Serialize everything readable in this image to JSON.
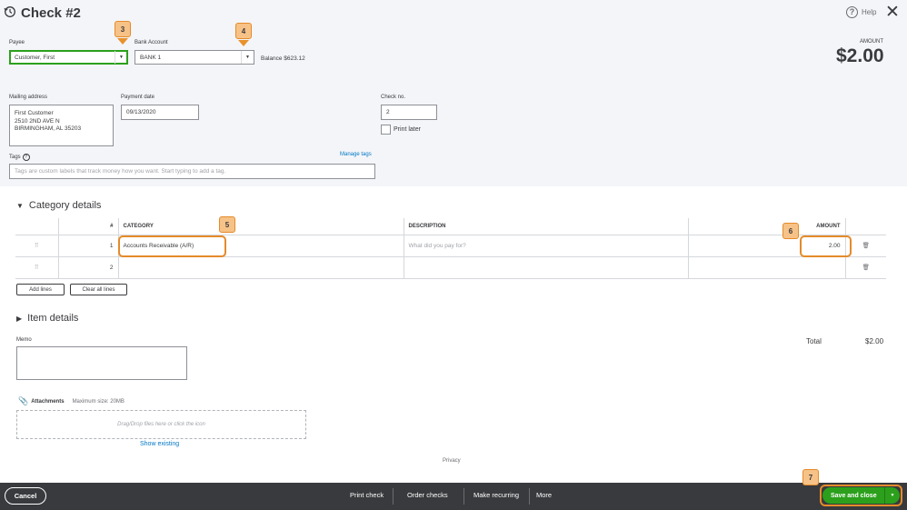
{
  "header": {
    "title": "Check #2",
    "help_label": "Help",
    "close_glyph": "✕",
    "history_icon": "history-clock-icon"
  },
  "payee": {
    "label": "Payee",
    "value": "Customer, First"
  },
  "bank": {
    "label": "Bank Account",
    "value": "BANK 1",
    "balance": "Balance $623.12"
  },
  "amount": {
    "label": "AMOUNT",
    "value": "$2.00"
  },
  "mailing": {
    "label": "Mailing address",
    "lines": [
      "First Customer",
      "2510 2ND AVE N",
      "BIRMINGHAM, AL  35203"
    ]
  },
  "payment_date": {
    "label": "Payment date",
    "value": "09/13/2020"
  },
  "check_no": {
    "label": "Check no.",
    "value": "2",
    "print_later": "Print later"
  },
  "tags": {
    "label": "Tags",
    "manage": "Manage tags",
    "placeholder": "Tags are custom labels that track money how you want. Start typing to add a tag."
  },
  "callouts": [
    "3",
    "4",
    "5",
    "6",
    "7"
  ],
  "category": {
    "title": "Category details",
    "headers": {
      "num": "#",
      "category": "CATEGORY",
      "description": "DESCRIPTION",
      "amount": "AMOUNT"
    },
    "rows": [
      {
        "num": "1",
        "category": "Accounts Receivable (A/R)",
        "description_placeholder": "What did you pay for?",
        "amount": "2.00"
      },
      {
        "num": "2",
        "category": "",
        "description_placeholder": "",
        "amount": ""
      }
    ],
    "add_lines": "Add lines",
    "clear_lines": "Clear all lines"
  },
  "item_details": {
    "title": "Item details"
  },
  "memo": {
    "label": "Memo"
  },
  "totals": {
    "label": "Total",
    "value": "$2.00"
  },
  "attachments": {
    "label": "Attachments",
    "max_size": "Maximum size: 20MB",
    "drop_text": "Drag/Drop files here or click the icon",
    "show_existing": "Show existing"
  },
  "privacy": "Privacy",
  "footer": {
    "cancel": "Cancel",
    "print_check": "Print check",
    "order_checks": "Order checks",
    "make_recurring": "Make recurring",
    "more": "More",
    "save_close": "Save and close"
  },
  "colors": {
    "brand_green": "#2ca01c",
    "link_blue": "#0077c5",
    "callout_orange": "#e48b2a",
    "footer_bg": "#393a3d"
  }
}
